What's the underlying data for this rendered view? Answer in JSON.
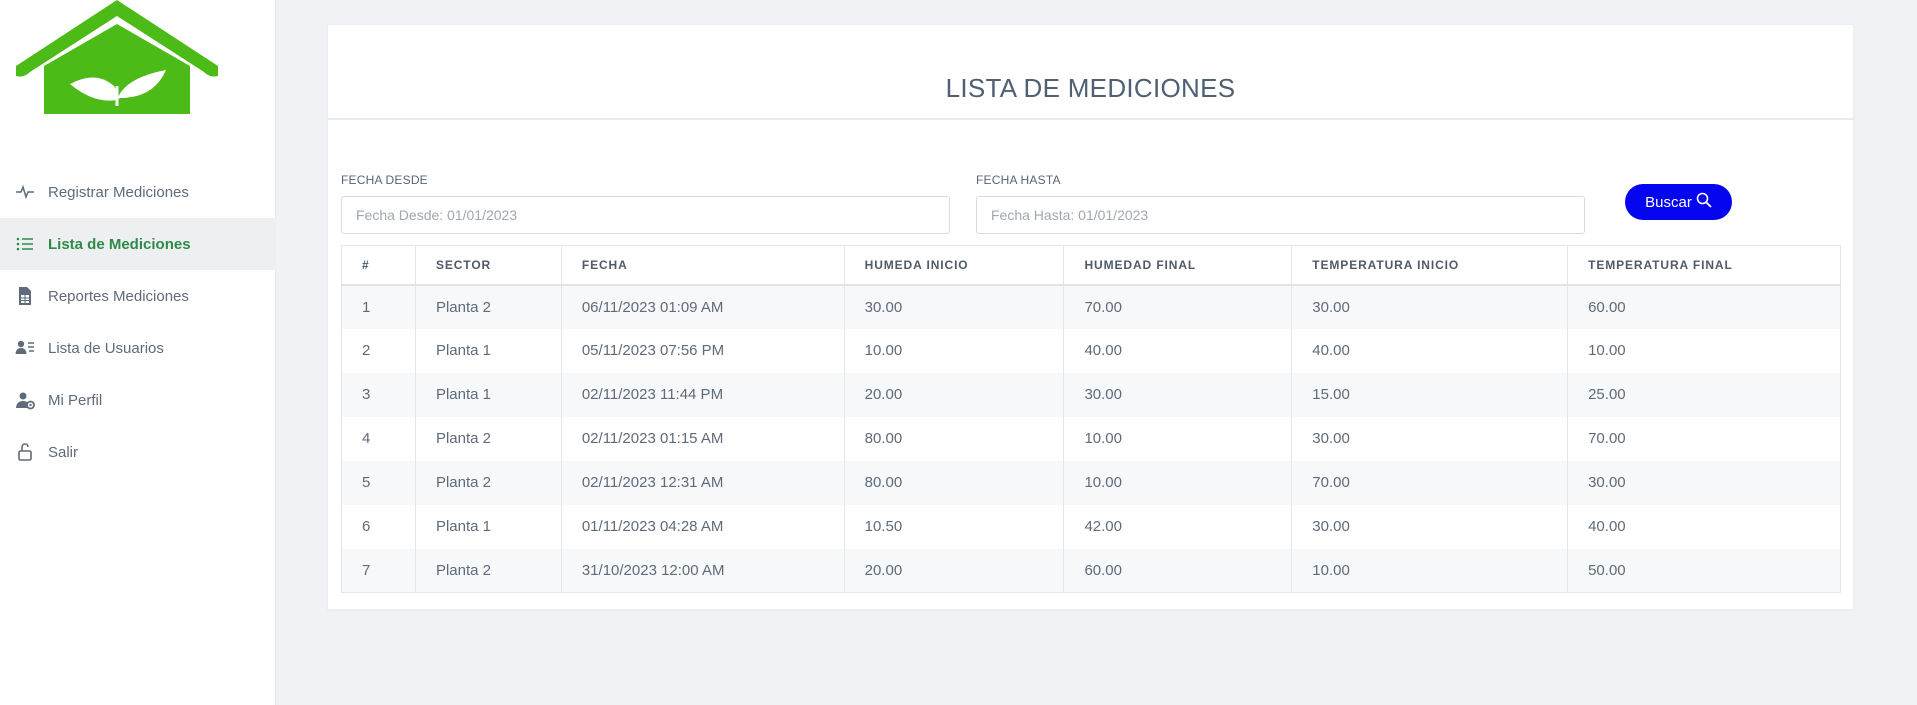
{
  "sidebar": {
    "items": [
      {
        "label": "Registrar Mediciones",
        "icon": "activity-icon"
      },
      {
        "label": "Lista de Mediciones",
        "icon": "list-icon",
        "active": true
      },
      {
        "label": "Reportes Mediciones",
        "icon": "spreadsheet-icon"
      },
      {
        "label": "Lista de Usuarios",
        "icon": "users-list-icon"
      },
      {
        "label": "Mi Perfil",
        "icon": "user-gear-icon"
      },
      {
        "label": "Salir",
        "icon": "unlock-icon"
      }
    ]
  },
  "main": {
    "title": "LISTA DE MEDICIONES",
    "filters": {
      "desde_label": "FECHA DESDE",
      "desde_placeholder": "Fecha Desde: 01/01/2023",
      "hasta_label": "FECHA HASTA",
      "hasta_placeholder": "Fecha Hasta: 01/01/2023",
      "buscar_label": "Buscar"
    },
    "table": {
      "headers": [
        "#",
        "SECTOR",
        "FECHA",
        "HUMEDA INICIO",
        "HUMEDAD FINAL",
        "TEMPERATURA INICIO",
        "TEMPERATURA FINAL"
      ],
      "rows": [
        [
          "1",
          "Planta 2",
          "06/11/2023 01:09 AM",
          "30.00",
          "70.00",
          "30.00",
          "60.00"
        ],
        [
          "2",
          "Planta 1",
          "05/11/2023 07:56 PM",
          "10.00",
          "40.00",
          "40.00",
          "10.00"
        ],
        [
          "3",
          "Planta 1",
          "02/11/2023 11:44 PM",
          "20.00",
          "30.00",
          "15.00",
          "25.00"
        ],
        [
          "4",
          "Planta 2",
          "02/11/2023 01:15 AM",
          "80.00",
          "10.00",
          "30.00",
          "70.00"
        ],
        [
          "5",
          "Planta 2",
          "02/11/2023 12:31 AM",
          "80.00",
          "10.00",
          "70.00",
          "30.00"
        ],
        [
          "6",
          "Planta 1",
          "01/11/2023 04:28 AM",
          "10.50",
          "42.00",
          "30.00",
          "40.00"
        ],
        [
          "7",
          "Planta 2",
          "31/10/2023 12:00 AM",
          "20.00",
          "60.00",
          "10.00",
          "50.00"
        ]
      ]
    }
  },
  "colors": {
    "brand_green": "#4cbb17",
    "active_nav_text": "#2e8b4a",
    "button_blue": "#0505ef"
  }
}
